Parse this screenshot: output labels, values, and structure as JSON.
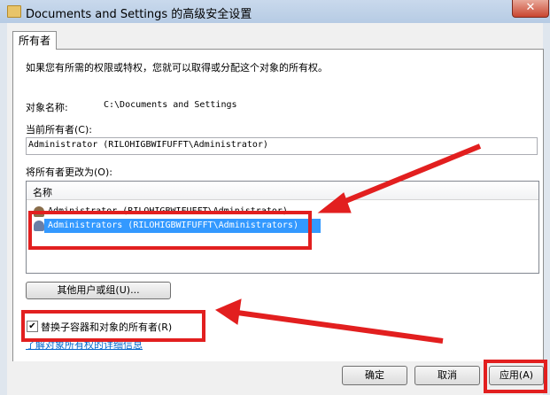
{
  "window": {
    "title": "Documents and Settings 的高级安全设置",
    "close_glyph": "✕"
  },
  "tabs": [
    {
      "label": "所有者"
    }
  ],
  "owner_tab": {
    "description": "如果您有所需的权限或特权，您就可以取得或分配这个对象的所有权。",
    "object_name_label": "对象名称:",
    "object_name_value": "C:\\Documents and Settings",
    "current_owner_label": "当前所有者(C):",
    "current_owner_value": "Administrator (RILOHIGBWIFUFFT\\Administrator)",
    "change_owner_label": "将所有者更改为(O):",
    "list_header": "名称",
    "list_items": [
      {
        "label": "Administrator (RILOHIGBWIFUFFT\\Administrator)",
        "selected": false,
        "icon": "user-icon"
      },
      {
        "label": "Administrators (RILOHIGBWIFUFFT\\Administrators)",
        "selected": true,
        "icon": "users-group-icon"
      }
    ],
    "other_users_button": "其他用户或组(U)...",
    "replace_owner_checkbox": {
      "label": "替换子容器和对象的所有者(R)",
      "checked": true
    },
    "help_link": "了解对象所有权的详细信息"
  },
  "footer": {
    "ok_label": "确定",
    "cancel_label": "取消",
    "apply_label": "应用(A)"
  },
  "colors": {
    "selection": "#3399ff",
    "annotation_red": "#e21f1f",
    "link": "#0066cc"
  }
}
